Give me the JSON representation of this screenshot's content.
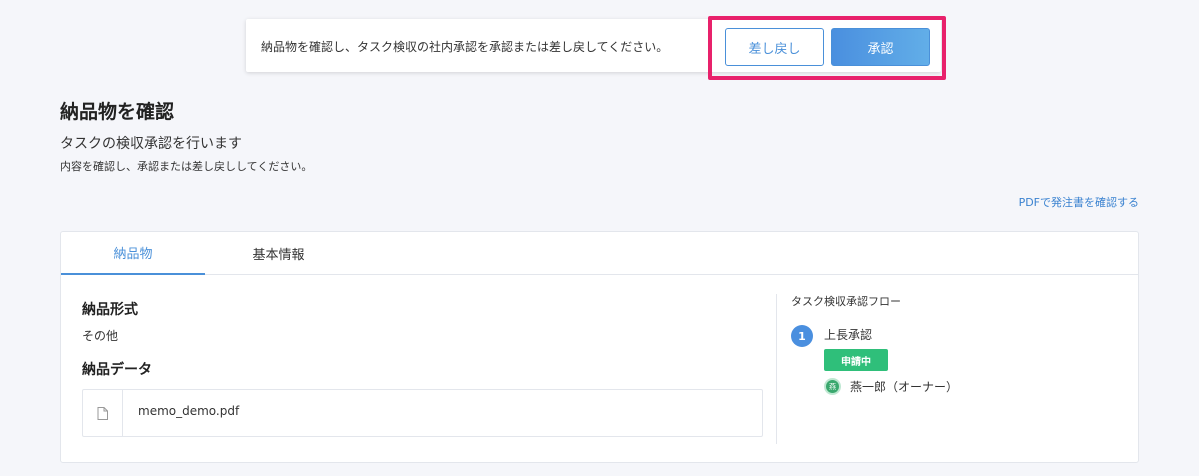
{
  "notice": {
    "text": "納品物を確認し、タスク検収の社内承認を承認または差し戻してください。",
    "back_label": "差し戻し",
    "approve_label": "承認"
  },
  "header": {
    "title": "納品物を確認",
    "subtitle": "タスクの検収承認を行います",
    "description": "内容を確認し、承認または差し戻ししてください。",
    "pdf_link": "PDFで発注書を確認する"
  },
  "tabs": [
    {
      "label": "納品物"
    },
    {
      "label": "基本情報"
    }
  ],
  "delivery": {
    "format_heading": "納品形式",
    "format_value": "その他",
    "data_heading": "納品データ",
    "file_name": "memo_demo.pdf"
  },
  "flow": {
    "heading": "タスク検収承認フロー",
    "step_number": "1",
    "step_label": "上長承認",
    "status_badge": "申請中",
    "avatar_char": "燕",
    "person": "燕一郎（オーナー）"
  },
  "colors": {
    "accent": "#4a90d9",
    "highlight": "#e8216b",
    "badge_green": "#2fbf7a"
  }
}
